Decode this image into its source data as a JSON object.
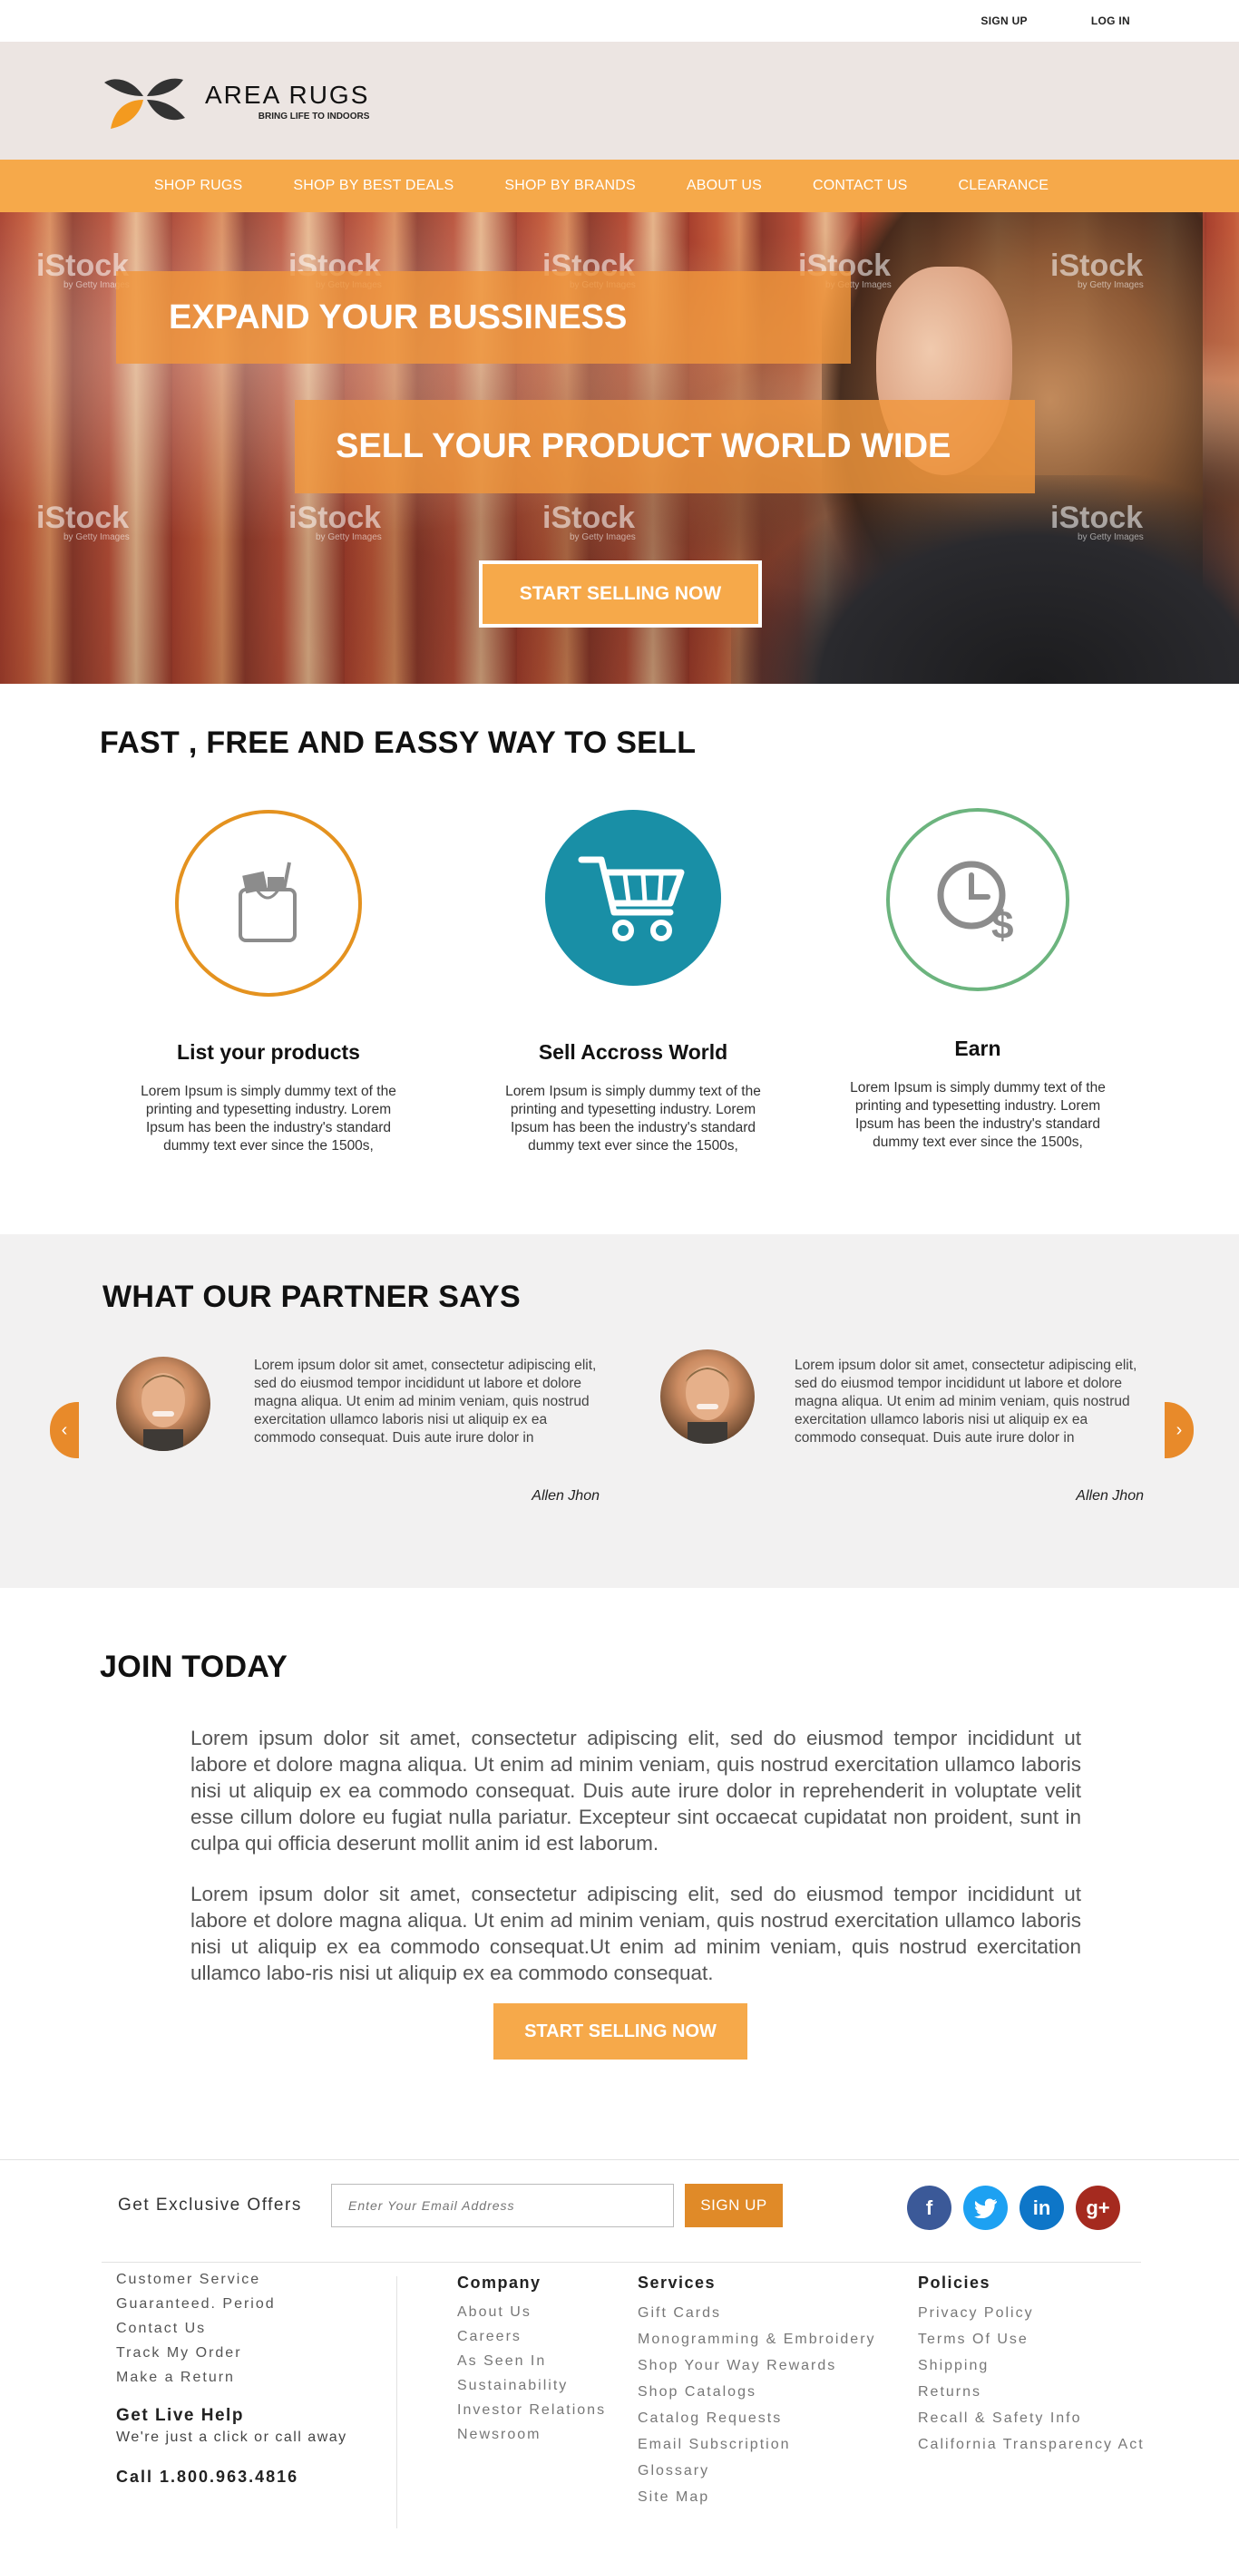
{
  "topbar": {
    "signup": "SIGN UP",
    "login": "LOG IN"
  },
  "brand": {
    "name": "AREA RUGS",
    "tagline": "BRING LIFE TO INDOORS",
    "colors": {
      "orange": "#f6a94a",
      "dark_orange": "#e08a28",
      "header_bg": "#ece5e2"
    }
  },
  "nav": {
    "items": [
      "SHOP RUGS",
      "SHOP BY BEST DEALS",
      "SHOP BY BRANDS",
      "ABOUT US",
      "CONTACT  US",
      "CLEARANCE"
    ]
  },
  "hero": {
    "headline": "EXPAND YOUR BUSSINESS",
    "subheadline": "SELL YOUR PRODUCT WORLD WIDE",
    "cta": "START SELLING NOW",
    "watermark": "iStock",
    "watermark_sub": "by Getty Images"
  },
  "fast": {
    "title": "FAST , FREE  AND EASSY  WAY  TO  SELL",
    "features": [
      {
        "title": "List your products",
        "icon": "shopping-bag-icon",
        "text": "Lorem Ipsum is simply dummy text of the printing and typesetting industry. Lorem Ipsum has been the industry's standard dummy text ever since the 1500s,"
      },
      {
        "title": "Sell Accross World",
        "icon": "cart-icon",
        "text": "Lorem Ipsum is simply dummy text of the printing and typesetting industry. Lorem Ipsum has been the industry's standard dummy text ever since the 1500s,"
      },
      {
        "title": "Earn",
        "icon": "clock-dollar-icon",
        "text": "Lorem Ipsum is simply dummy text of the printing and typesetting industry. Lorem Ipsum has been the industry's standard dummy text ever since the 1500s,"
      }
    ]
  },
  "partners": {
    "title": "WHAT OUR PARTNER SAYS",
    "prev": "‹",
    "next": "›",
    "testimonials": [
      {
        "quote": "Lorem ipsum dolor sit amet, consectetur adipiscing elit, sed do eiusmod tempor incididunt ut labore et dolore magna aliqua. Ut enim ad minim veniam, quis nostrud exercitation ullamco laboris nisi ut aliquip ex ea commodo consequat. Duis aute irure dolor in",
        "author": "Allen Jhon"
      },
      {
        "quote": "Lorem ipsum dolor sit amet, consectetur adipiscing elit, sed do eiusmod tempor incididunt ut labore et dolore magna aliqua. Ut enim ad minim veniam, quis nostrud exercitation ullamco laboris nisi ut aliquip ex ea commodo consequat. Duis aute irure dolor in",
        "author": "Allen Jhon"
      }
    ]
  },
  "join": {
    "title": "JOIN TODAY",
    "paragraphs": [
      "Lorem ipsum dolor sit amet, consectetur adipiscing elit, sed do eiusmod tempor incididunt ut labore et dolore magna aliqua. Ut enim ad minim veniam, quis nostrud exercitation ullamco laboris nisi ut aliquip ex ea commodo consequat. Duis aute irure dolor in reprehenderit in voluptate velit esse cillum dolore eu fugiat nulla pariatur. Excepteur sint occaecat cupidatat non proident, sunt in culpa qui officia deserunt mollit anim id est laborum.",
      "Lorem ipsum dolor sit amet, consectetur adipiscing elit, sed do eiusmod tempor incididunt ut labore et dolore magna aliqua. Ut enim ad minim veniam, quis nostrud exercitation ullamco laboris nisi ut aliquip ex ea commodo consequat.Ut enim ad minim veniam, quis nostrud exercitation ullamco labo-ris nisi ut aliquip ex ea commodo consequat."
    ],
    "cta": "START SELLING NOW"
  },
  "footer": {
    "offers_label": "Get Exclusive Offers",
    "email_placeholder": "Enter Your Email Address",
    "signup": "SIGN UP",
    "socials": [
      {
        "icon": "facebook-icon",
        "glyph": "f",
        "color": "#3b5998"
      },
      {
        "icon": "twitter-icon",
        "glyph": "t",
        "color": "#1da1f2"
      },
      {
        "icon": "linkedin-icon",
        "glyph": "in",
        "color": "#0e76c8"
      },
      {
        "icon": "google-plus-icon",
        "glyph": "g+",
        "color": "#a52a1f"
      }
    ],
    "customer_links": [
      "Customer Service",
      "Guaranteed. Period",
      "Contact Us",
      "Track My Order",
      "Make a Return"
    ],
    "help_title": "Get Live Help",
    "help_sub": "We're just a click or call away",
    "call": "Call 1.800.963.4816",
    "company": {
      "title": "Company",
      "links": [
        "About Us",
        "Careers",
        "As Seen In",
        "Sustainability",
        "Investor Relations",
        "Newsroom"
      ]
    },
    "services": {
      "title": "Services",
      "links": [
        "Gift Cards",
        "Monogramming & Embroidery",
        "Shop Your Way Rewards",
        "Shop Catalogs",
        "Catalog Requests",
        "Email Subscription",
        "Glossary",
        "Site Map"
      ]
    },
    "policies": {
      "title": "Policies",
      "links": [
        "Privacy Policy",
        "Terms Of Use",
        "Shipping",
        "Returns",
        "Recall & Safety Info",
        "California Transparency Act"
      ]
    }
  }
}
